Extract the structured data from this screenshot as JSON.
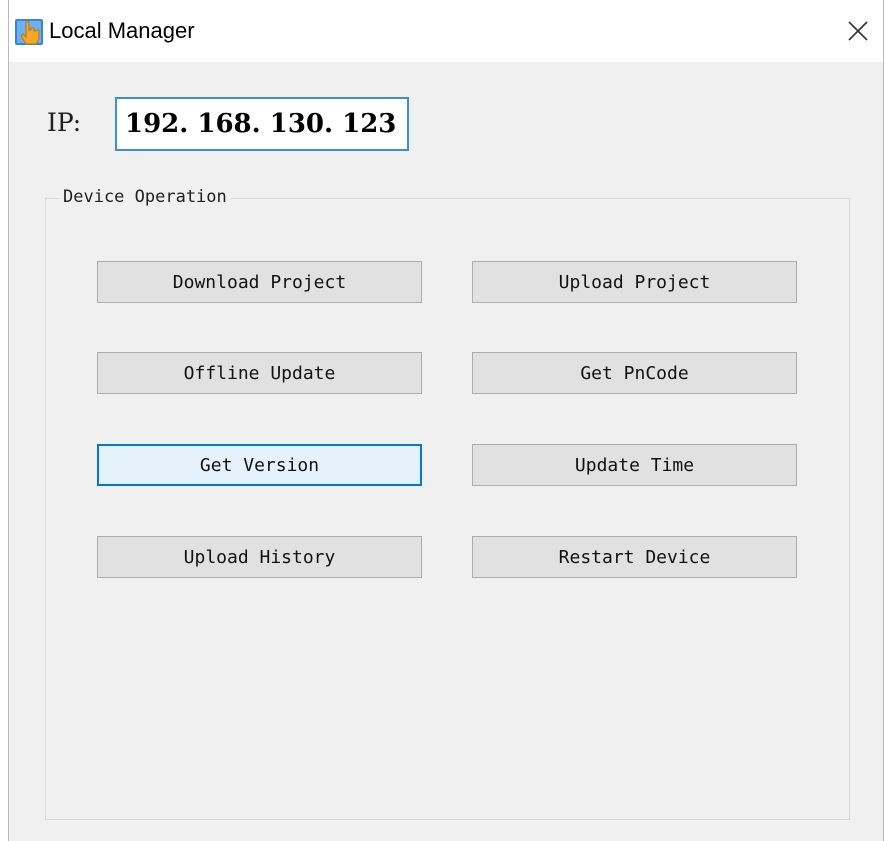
{
  "window": {
    "title": "Local Manager",
    "icon": "hand-pointer-icon",
    "close_icon": "close-icon"
  },
  "ip": {
    "label": "IP:",
    "value": "192. 168. 130. 123"
  },
  "device_operation": {
    "legend": "Device Operation",
    "buttons": [
      {
        "label": "Download Project"
      },
      {
        "label": "Upload Project"
      },
      {
        "label": "Offline Update"
      },
      {
        "label": "Get PnCode"
      },
      {
        "label": "Get Version",
        "focused": true
      },
      {
        "label": "Update Time"
      },
      {
        "label": "Upload History"
      },
      {
        "label": "Restart Device"
      }
    ]
  },
  "colors": {
    "window_bg": "#f0f0f0",
    "button_bg": "#e1e1e1",
    "focus_border": "#0078d7",
    "input_border": "#3c8fd6"
  }
}
